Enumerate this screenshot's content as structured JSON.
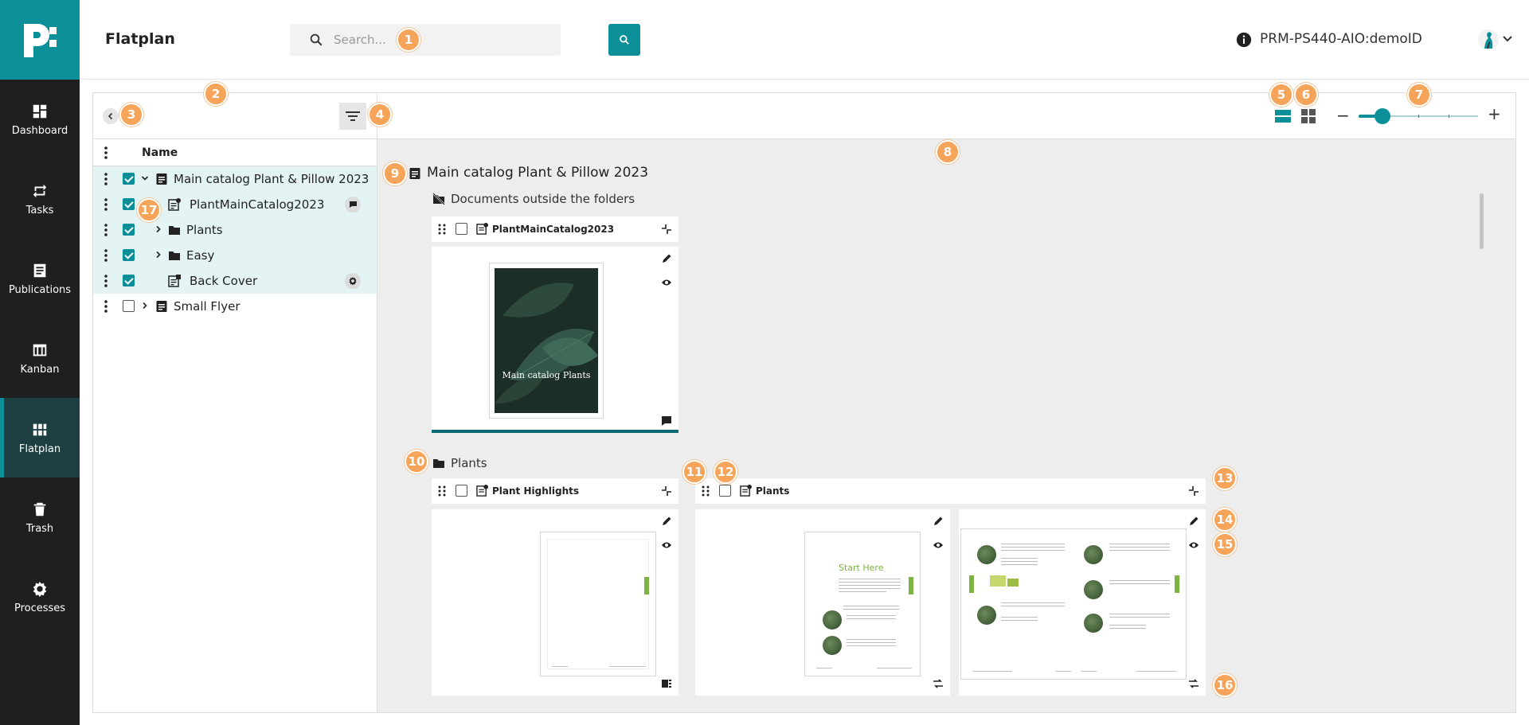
{
  "app": {
    "title": "Flatplan",
    "environment": "PRM-PS440-AIO:demoID"
  },
  "search": {
    "placeholder": "Search..."
  },
  "sidebar": {
    "items": [
      {
        "label": "Dashboard",
        "icon": "dashboard-icon"
      },
      {
        "label": "Tasks",
        "icon": "tasks-icon"
      },
      {
        "label": "Publications",
        "icon": "publications-icon"
      },
      {
        "label": "Kanban",
        "icon": "kanban-icon"
      },
      {
        "label": "Flatplan",
        "icon": "flatplan-icon",
        "active": true
      },
      {
        "label": "Trash",
        "icon": "trash-icon"
      },
      {
        "label": "Processes",
        "icon": "processes-icon"
      }
    ]
  },
  "tree": {
    "column_name": "Name",
    "rows": [
      {
        "label": "Main catalog Plant & Pillow 2023",
        "checked": true,
        "expanded": true,
        "icon": "publication-icon"
      },
      {
        "label": "PlantMainCatalog2023",
        "checked": true,
        "icon": "document-icon",
        "badge": "comment-icon"
      },
      {
        "label": "Plants",
        "checked": true,
        "icon": "folder-icon",
        "collapsed": true
      },
      {
        "label": "Easy",
        "checked": true,
        "icon": "folder-icon",
        "collapsed": true
      },
      {
        "label": "Back Cover",
        "checked": true,
        "icon": "document-icon",
        "badge": "gear-icon"
      },
      {
        "label": "Small Flyer",
        "checked": false,
        "icon": "publication-icon",
        "collapsed": true
      }
    ]
  },
  "zoom": {
    "level": 0.2
  },
  "flatplan": {
    "publication_title": "Main catalog Plant & Pillow 2023",
    "outside_label": "Documents outside the folders",
    "cover_doc": {
      "title": "PlantMainCatalog2023",
      "cover_text": "Main catalog Plants"
    },
    "folder_label": "Plants",
    "folder_docs": [
      {
        "title": "Plant Highlights"
      },
      {
        "title": "Plants"
      }
    ],
    "start_here": "Start Here"
  },
  "callouts": [
    "1",
    "2",
    "3",
    "4",
    "5",
    "6",
    "7",
    "8",
    "9",
    "10",
    "11",
    "12",
    "13",
    "14",
    "15",
    "16",
    "17"
  ],
  "colors": {
    "accent": "#0b8f98",
    "sidebar": "#1f1f1f",
    "callout": "#f5a45a"
  }
}
